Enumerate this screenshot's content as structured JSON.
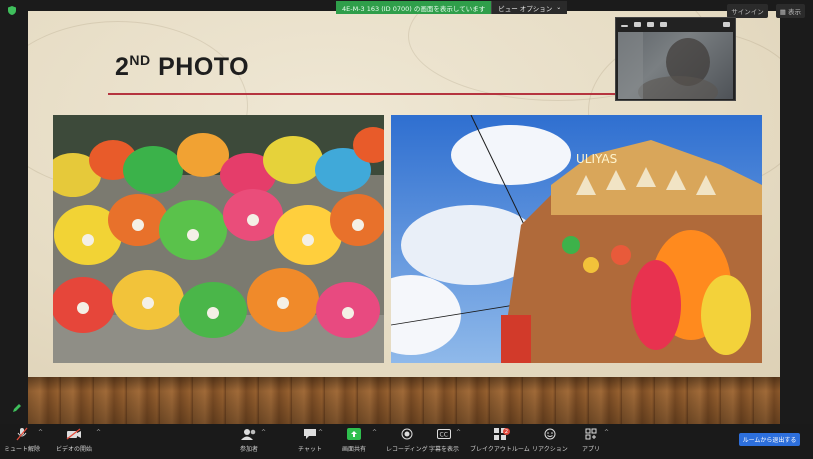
{
  "share_bar": {
    "status_text": "4E-M-3  163 (ID 0700)  の画面を表示しています",
    "view_options_label": "ビュー オプション"
  },
  "top_right": {
    "signin_label": "サインイン",
    "display_label": "表示"
  },
  "slide": {
    "title_main": "2",
    "title_sup": "ND",
    "title_rest": " PHOTO"
  },
  "toolbar": {
    "items": [
      {
        "label": "ミュート解除",
        "icon": "microphone-muted-icon"
      },
      {
        "label": "ビデオの開始",
        "icon": "video-off-icon"
      },
      {
        "label": "参加者",
        "icon": "participants-icon"
      },
      {
        "label": "チャット",
        "icon": "chat-icon"
      },
      {
        "label": "画面共有",
        "icon": "share-screen-icon"
      },
      {
        "label": "レコーディング",
        "icon": "record-icon"
      },
      {
        "label": "字幕を表示",
        "icon": "captions-icon"
      },
      {
        "label": "ブレイクアウトルーム",
        "icon": "breakout-icon"
      },
      {
        "label": "リアクション",
        "icon": "reaction-icon"
      },
      {
        "label": "アプリ",
        "icon": "apps-icon"
      }
    ],
    "breakout_badge": "2",
    "end_button_label": "ルームから退出する"
  },
  "colors": {
    "share_green": "#2f9e4a",
    "title_rule": "#b5343f",
    "end_blue": "#2d6fdc"
  }
}
